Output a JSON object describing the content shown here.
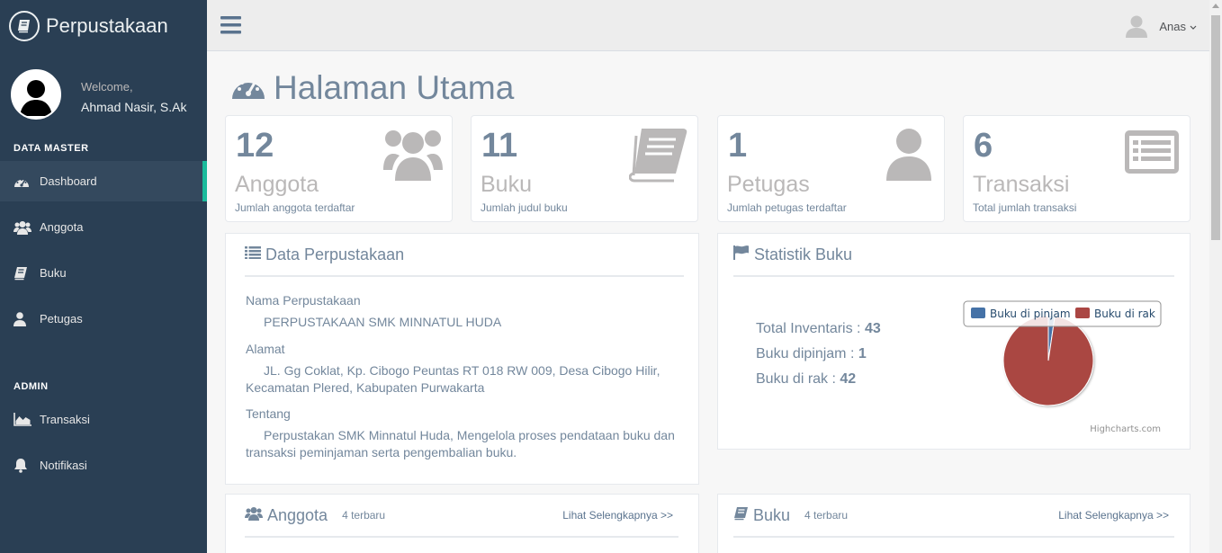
{
  "sidebar": {
    "brand": "Perpustakaan",
    "welcome": "Welcome,",
    "username": "Ahmad Nasir, S.Ak",
    "sections": [
      {
        "title": "DATA MASTER",
        "items": [
          {
            "label": "Dashboard",
            "icon": "dashboard-icon",
            "active": true
          },
          {
            "label": "Anggota",
            "icon": "users-icon"
          },
          {
            "label": "Buku",
            "icon": "book-icon"
          },
          {
            "label": "Petugas",
            "icon": "user-icon"
          }
        ]
      },
      {
        "title": "ADMIN",
        "items": [
          {
            "label": "Transaksi",
            "icon": "area-chart-icon"
          },
          {
            "label": "Notifikasi",
            "icon": "bell-icon"
          }
        ]
      }
    ]
  },
  "topbar": {
    "user": "Anas"
  },
  "page": {
    "title": "Halaman Utama"
  },
  "tiles": [
    {
      "count": "12",
      "label": "Anggota",
      "desc": "Jumlah anggota terdaftar",
      "icon": "users-icon"
    },
    {
      "count": "11",
      "label": "Buku",
      "desc": "Jumlah judul buku",
      "icon": "book-icon"
    },
    {
      "count": "1",
      "label": "Petugas",
      "desc": "Jumlah petugas terdaftar",
      "icon": "user-icon"
    },
    {
      "count": "6",
      "label": "Transaksi",
      "desc": "Total jumlah transaksi",
      "icon": "list-alt-icon"
    }
  ],
  "library_panel": {
    "title": "Data Perpustakaan",
    "name_label": "Nama Perpustakaan",
    "name_value": "PERPUSTAKAAN SMK MINNATUL HUDA",
    "address_label": "Alamat",
    "address_line1": "JL. Gg Coklat, Kp. Cibogo Peuntas RT 018 RW 009, Desa Cibogo Hilir,",
    "address_line2": "Kecamatan Plered, Kabupaten Purwakarta",
    "about_label": "Tentang",
    "about_line1": "Perpustakan SMK Minnatul Huda, Mengelola proses pendataan buku dan",
    "about_line2": "transaksi peminjaman serta pengembalian buku."
  },
  "stats_panel": {
    "title": "Statistik Buku",
    "total_label": "Total Inventaris : ",
    "total_value": "43",
    "borrowed_label": "Buku dipinjam : ",
    "borrowed_value": "1",
    "shelf_label": "Buku di rak : ",
    "shelf_value": "42",
    "credit": "Highcharts.com"
  },
  "chart_data": {
    "type": "pie",
    "categories": [
      "Buku di pinjam",
      "Buku di rak"
    ],
    "values": [
      1,
      42
    ],
    "colors": [
      "#4572A7",
      "#AA4643"
    ],
    "legend": "top"
  },
  "members_panel": {
    "title": "Anggota",
    "sub": "4 terbaru",
    "more": "Lihat Selengkapnya >>"
  },
  "books_panel": {
    "title": "Buku",
    "sub": "4 terbaru",
    "more": "Lihat Selengkapnya >>"
  }
}
